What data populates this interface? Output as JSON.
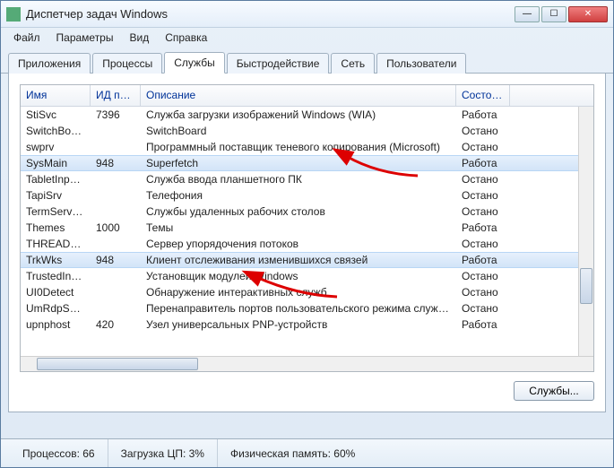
{
  "window": {
    "title": "Диспетчер задач Windows"
  },
  "menu": {
    "file": "Файл",
    "options": "Параметры",
    "view": "Вид",
    "help": "Справка"
  },
  "tabs": {
    "apps": "Приложения",
    "processes": "Процессы",
    "services": "Службы",
    "performance": "Быстродействие",
    "network": "Сеть",
    "users": "Пользователи"
  },
  "columns": {
    "name": "Имя",
    "pid": "ИД пр...",
    "desc": "Описание",
    "status": "Состоя..."
  },
  "rows": [
    {
      "name": "StiSvc",
      "pid": "7396",
      "desc": "Служба загрузки изображений Windows (WIA)",
      "status": "Работа",
      "selected": false
    },
    {
      "name": "SwitchBoard",
      "pid": "",
      "desc": "SwitchBoard",
      "status": "Остано",
      "selected": false
    },
    {
      "name": "swprv",
      "pid": "",
      "desc": "Программный поставщик теневого копирования (Microsoft)",
      "status": "Остано",
      "selected": false
    },
    {
      "name": "SysMain",
      "pid": "948",
      "desc": "Superfetch",
      "status": "Работа",
      "selected": true
    },
    {
      "name": "TabletInput...",
      "pid": "",
      "desc": "Служба ввода планшетного ПК",
      "status": "Остано",
      "selected": false
    },
    {
      "name": "TapiSrv",
      "pid": "",
      "desc": "Телефония",
      "status": "Остано",
      "selected": false
    },
    {
      "name": "TermService",
      "pid": "",
      "desc": "Службы удаленных рабочих столов",
      "status": "Остано",
      "selected": false
    },
    {
      "name": "Themes",
      "pid": "1000",
      "desc": "Темы",
      "status": "Работа",
      "selected": false
    },
    {
      "name": "THREADOR...",
      "pid": "",
      "desc": "Сервер упорядочения потоков",
      "status": "Остано",
      "selected": false
    },
    {
      "name": "TrkWks",
      "pid": "948",
      "desc": "Клиент отслеживания изменившихся связей",
      "status": "Работа",
      "selected": true
    },
    {
      "name": "TrustedInst...",
      "pid": "",
      "desc": "Установщик модулей Windows",
      "status": "Остано",
      "selected": false
    },
    {
      "name": "UI0Detect",
      "pid": "",
      "desc": "Обнаружение интерактивных служб",
      "status": "Остано",
      "selected": false
    },
    {
      "name": "UmRdpServ...",
      "pid": "",
      "desc": "Перенаправитель портов пользовательского режима служб удал...",
      "status": "Остано",
      "selected": false
    },
    {
      "name": "upnphost",
      "pid": "420",
      "desc": "Узел универсальных PNP-устройств",
      "status": "Работа",
      "selected": false
    }
  ],
  "buttons": {
    "services": "Службы..."
  },
  "status": {
    "processes": "Процессов: 66",
    "cpu": "Загрузка ЦП: 3%",
    "mem": "Физическая память: 60%"
  }
}
